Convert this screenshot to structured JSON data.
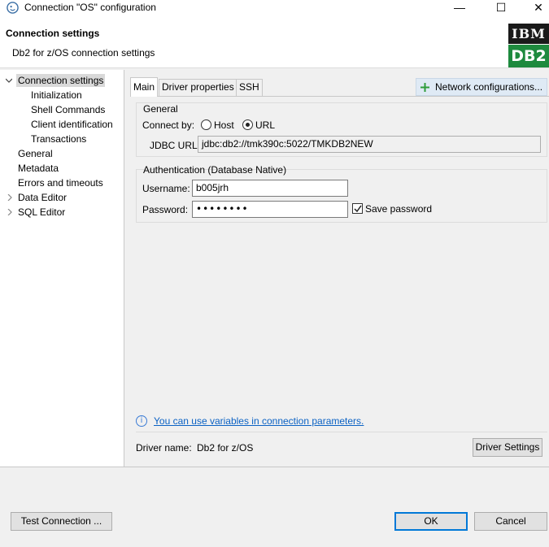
{
  "window": {
    "title": "Connection \"OS\" configuration",
    "minimize": "—",
    "maximize": "☐",
    "close": "✕"
  },
  "header": {
    "title": "Connection settings",
    "subtitle": "Db2 for z/OS connection settings",
    "logo_top": "IBM",
    "logo_bottom": "DB2"
  },
  "tree": {
    "items": [
      {
        "label": "Connection settings"
      },
      {
        "label": "Initialization"
      },
      {
        "label": "Shell Commands"
      },
      {
        "label": "Client identification"
      },
      {
        "label": "Transactions"
      },
      {
        "label": "General"
      },
      {
        "label": "Metadata"
      },
      {
        "label": "Errors and timeouts"
      },
      {
        "label": "Data Editor"
      },
      {
        "label": "SQL Editor"
      }
    ]
  },
  "tabs": [
    {
      "label": "Main"
    },
    {
      "label": "Driver properties"
    },
    {
      "label": "SSH"
    }
  ],
  "network_button": "Network configurations...",
  "general": {
    "title": "General",
    "connect_by_label": "Connect by:",
    "options": [
      "Host",
      "URL"
    ],
    "selected": "URL",
    "jdbc_label": "JDBC URL:",
    "jdbc_value": "jdbc:db2://tmk390c:5022/TMKDB2NEW"
  },
  "auth": {
    "title": "Authentication (Database Native)",
    "username_label": "Username:",
    "username_value": "b005jrh",
    "password_label": "Password:",
    "password_value": "••••••••",
    "save_password_label": "Save password",
    "save_password_checked": true
  },
  "info_link": "You can use variables in connection parameters.",
  "driver": {
    "label": "Driver name:",
    "name": "Db2 for z/OS",
    "settings_button": "Driver Settings"
  },
  "footer": {
    "test_button": "Test Connection ...",
    "ok_button": "OK",
    "cancel_button": "Cancel"
  },
  "colors": {
    "accent": "#0078d7",
    "link": "#0b62c4",
    "logo_green": "#1e8a3e",
    "logo_black": "#1a1a1a"
  }
}
